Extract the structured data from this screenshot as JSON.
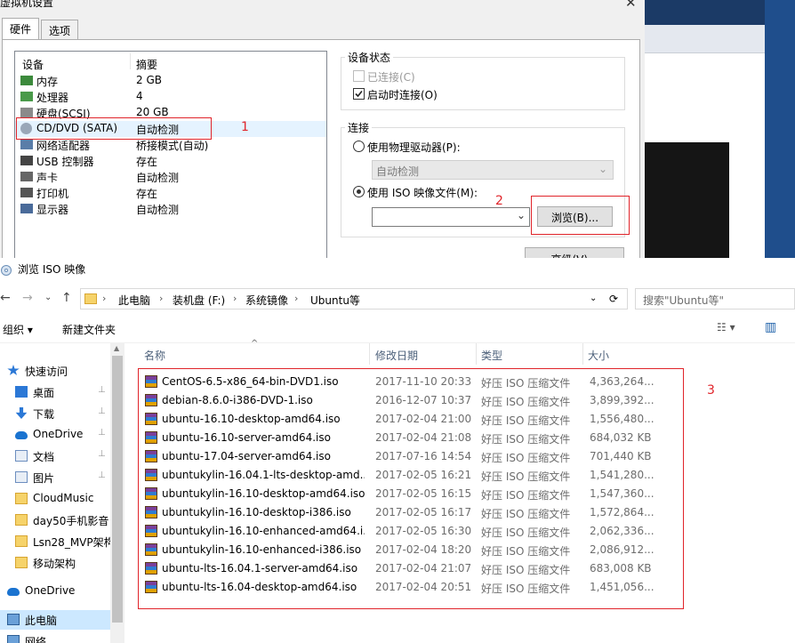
{
  "vm_dialog": {
    "title": "虚拟机设置",
    "close_glyph": "✕",
    "tabs": [
      "硬件",
      "选项"
    ],
    "device_header": {
      "device": "设备",
      "summary": "摘要"
    },
    "devices": [
      {
        "name": "内存",
        "value": "2 GB",
        "icon": "memory-icon"
      },
      {
        "name": "处理器",
        "value": "4",
        "icon": "cpu-icon"
      },
      {
        "name": "硬盘(SCSI)",
        "value": "20 GB",
        "icon": "hdd-icon"
      },
      {
        "name": "CD/DVD (SATA)",
        "value": "自动检测",
        "icon": "cd-icon"
      },
      {
        "name": "网络适配器",
        "value": "桥接模式(自动)",
        "icon": "network-icon"
      },
      {
        "name": "USB 控制器",
        "value": "存在",
        "icon": "usb-icon"
      },
      {
        "name": "声卡",
        "value": "自动检测",
        "icon": "sound-icon"
      },
      {
        "name": "打印机",
        "value": "存在",
        "icon": "printer-icon"
      },
      {
        "name": "显示器",
        "value": "自动检测",
        "icon": "display-icon"
      }
    ],
    "device_status": {
      "title": "设备状态",
      "connected": "已连接(C)",
      "connect_at_power_on": "启动时连接(O)"
    },
    "connection": {
      "title": "连接",
      "physical_drive": "使用物理驱动器(P):",
      "physical_drive_value": "自动检测",
      "iso_file": "使用 ISO 映像文件(M):",
      "iso_value": "",
      "browse_button": "浏览(B)...",
      "advanced_button": "高级(V)..."
    },
    "annotations": [
      "1",
      "2"
    ]
  },
  "file_browser": {
    "title": "浏览 ISO 映像",
    "nav": {
      "back": "←",
      "forward": "→",
      "up": "↑",
      "refresh": "⟳",
      "dropdown": "⌄"
    },
    "breadcrumb": [
      "此电脑",
      "装机盘 (F:)",
      "系统镜像",
      "Ubuntu等"
    ],
    "search_placeholder": "搜索\"Ubuntu等\"",
    "toolbar": {
      "organize": "组织 ▾",
      "new_folder": "新建文件夹",
      "view": "☷ ▾",
      "pane": "▥"
    },
    "sidebar": [
      {
        "label": "快速访问",
        "icon": "star-icon",
        "pinned": false
      },
      {
        "label": "桌面",
        "icon": "desktop-icon",
        "pinned": true
      },
      {
        "label": "下载",
        "icon": "download-icon",
        "pinned": true
      },
      {
        "label": "OneDrive",
        "icon": "cloud-icon",
        "pinned": true
      },
      {
        "label": "文档",
        "icon": "document-icon",
        "pinned": true
      },
      {
        "label": "图片",
        "icon": "picture-icon",
        "pinned": true
      },
      {
        "label": "CloudMusic",
        "icon": "folder-icon",
        "pinned": false
      },
      {
        "label": "day50手机影音",
        "icon": "folder-icon",
        "pinned": false
      },
      {
        "label": "Lsn28_MVP架构",
        "icon": "folder-icon",
        "pinned": false
      },
      {
        "label": "移动架构",
        "icon": "folder-icon",
        "pinned": false
      },
      {
        "label": "OneDrive",
        "icon": "cloud-icon",
        "pinned": false
      },
      {
        "label": "此电脑",
        "icon": "computer-icon",
        "pinned": false
      },
      {
        "label": "网络",
        "icon": "network-icon",
        "pinned": false
      }
    ],
    "pin_glyph": "📌",
    "columns": {
      "name": "名称",
      "date": "修改日期",
      "type": "类型",
      "size": "大小"
    },
    "files": [
      {
        "name": "CentOS-6.5-x86_64-bin-DVD1.iso",
        "date": "2017-11-10 20:33",
        "type": "好压 ISO 压缩文件",
        "size": "4,363,264..."
      },
      {
        "name": "debian-8.6.0-i386-DVD-1.iso",
        "date": "2016-12-07 10:37",
        "type": "好压 ISO 压缩文件",
        "size": "3,899,392..."
      },
      {
        "name": "ubuntu-16.10-desktop-amd64.iso",
        "date": "2017-02-04 21:00",
        "type": "好压 ISO 压缩文件",
        "size": "1,556,480..."
      },
      {
        "name": "ubuntu-16.10-server-amd64.iso",
        "date": "2017-02-04 21:08",
        "type": "好压 ISO 压缩文件",
        "size": "684,032 KB"
      },
      {
        "name": "ubuntu-17.04-server-amd64.iso",
        "date": "2017-07-16 14:54",
        "type": "好压 ISO 压缩文件",
        "size": "701,440 KB"
      },
      {
        "name": "ubuntukylin-16.04.1-lts-desktop-amd...",
        "date": "2017-02-05 16:21",
        "type": "好压 ISO 压缩文件",
        "size": "1,541,280..."
      },
      {
        "name": "ubuntukylin-16.10-desktop-amd64.iso",
        "date": "2017-02-05 16:15",
        "type": "好压 ISO 压缩文件",
        "size": "1,547,360..."
      },
      {
        "name": "ubuntukylin-16.10-desktop-i386.iso",
        "date": "2017-02-05 16:17",
        "type": "好压 ISO 压缩文件",
        "size": "1,572,864..."
      },
      {
        "name": "ubuntukylin-16.10-enhanced-amd64.i...",
        "date": "2017-02-05 16:30",
        "type": "好压 ISO 压缩文件",
        "size": "2,062,336..."
      },
      {
        "name": "ubuntukylin-16.10-enhanced-i386.iso",
        "date": "2017-02-04 18:20",
        "type": "好压 ISO 压缩文件",
        "size": "2,086,912..."
      },
      {
        "name": "ubuntu-lts-16.04.1-server-amd64.iso",
        "date": "2017-02-04 21:07",
        "type": "好压 ISO 压缩文件",
        "size": "683,008 KB"
      },
      {
        "name": "ubuntu-lts-16.04-desktop-amd64.iso",
        "date": "2017-02-04 20:51",
        "type": "好压 ISO 压缩文件",
        "size": "1,451,056..."
      }
    ],
    "annotation": "3"
  },
  "colors": {
    "annotation_red": "#e0242a",
    "selection": "#cce8ff"
  }
}
